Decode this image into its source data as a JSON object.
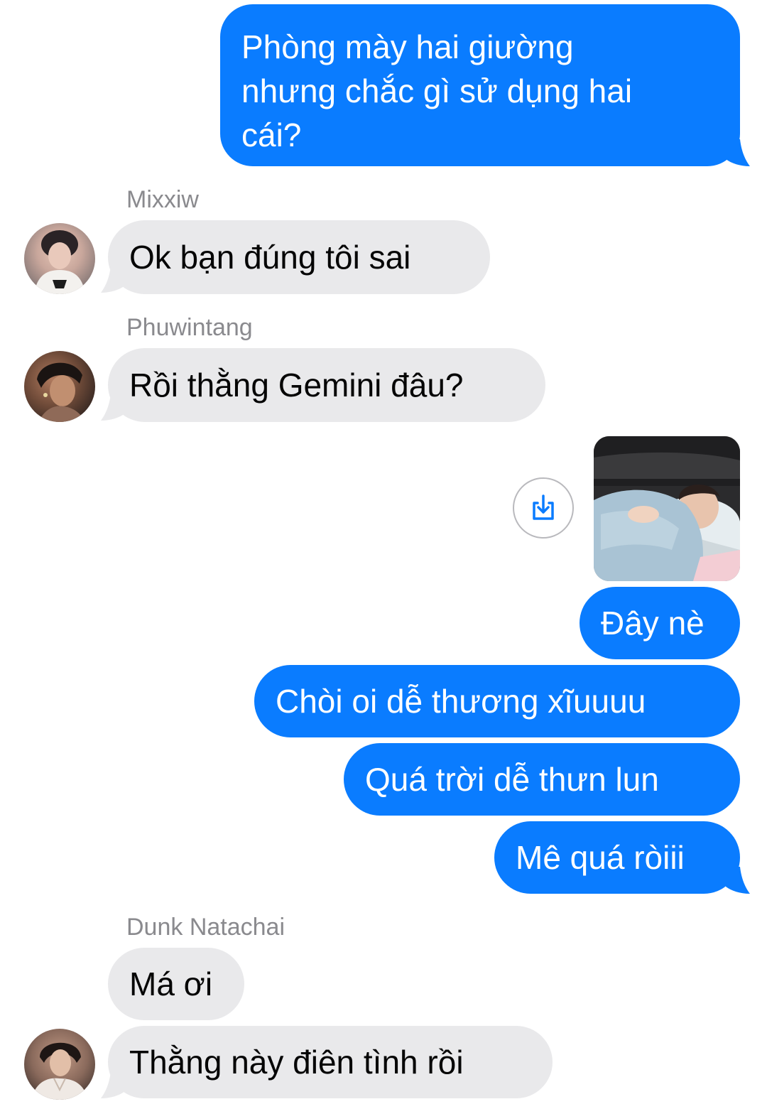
{
  "colors": {
    "outgoing_bubble": "#0a7cff",
    "incoming_bubble": "#e9e9eb",
    "sender_name": "#8a8a8e"
  },
  "messages": {
    "m1": {
      "line1": "Phòng mày hai giường",
      "line2": "nhưng chắc gì sử dụng hai",
      "line3": "cái?"
    },
    "m2": {
      "sender": "Mixxiw",
      "text": "Ok bạn đúng tôi sai"
    },
    "m3": {
      "sender": "Phuwintang",
      "text": "Rồi thằng Gemini đâu?"
    },
    "m4": {
      "type": "photo",
      "action_icon": "download-icon"
    },
    "m5": {
      "text": "Đây nè"
    },
    "m6": {
      "text": "Chòi oi dễ thương xĩuuuu"
    },
    "m7": {
      "text": "Quá trời dễ thưn lun"
    },
    "m8": {
      "text": "Mê quá ròiii"
    },
    "m9": {
      "sender": "Dunk Natachai",
      "text": "Má ơi"
    },
    "m10": {
      "text": "Thằng này điên tình rồi"
    }
  }
}
